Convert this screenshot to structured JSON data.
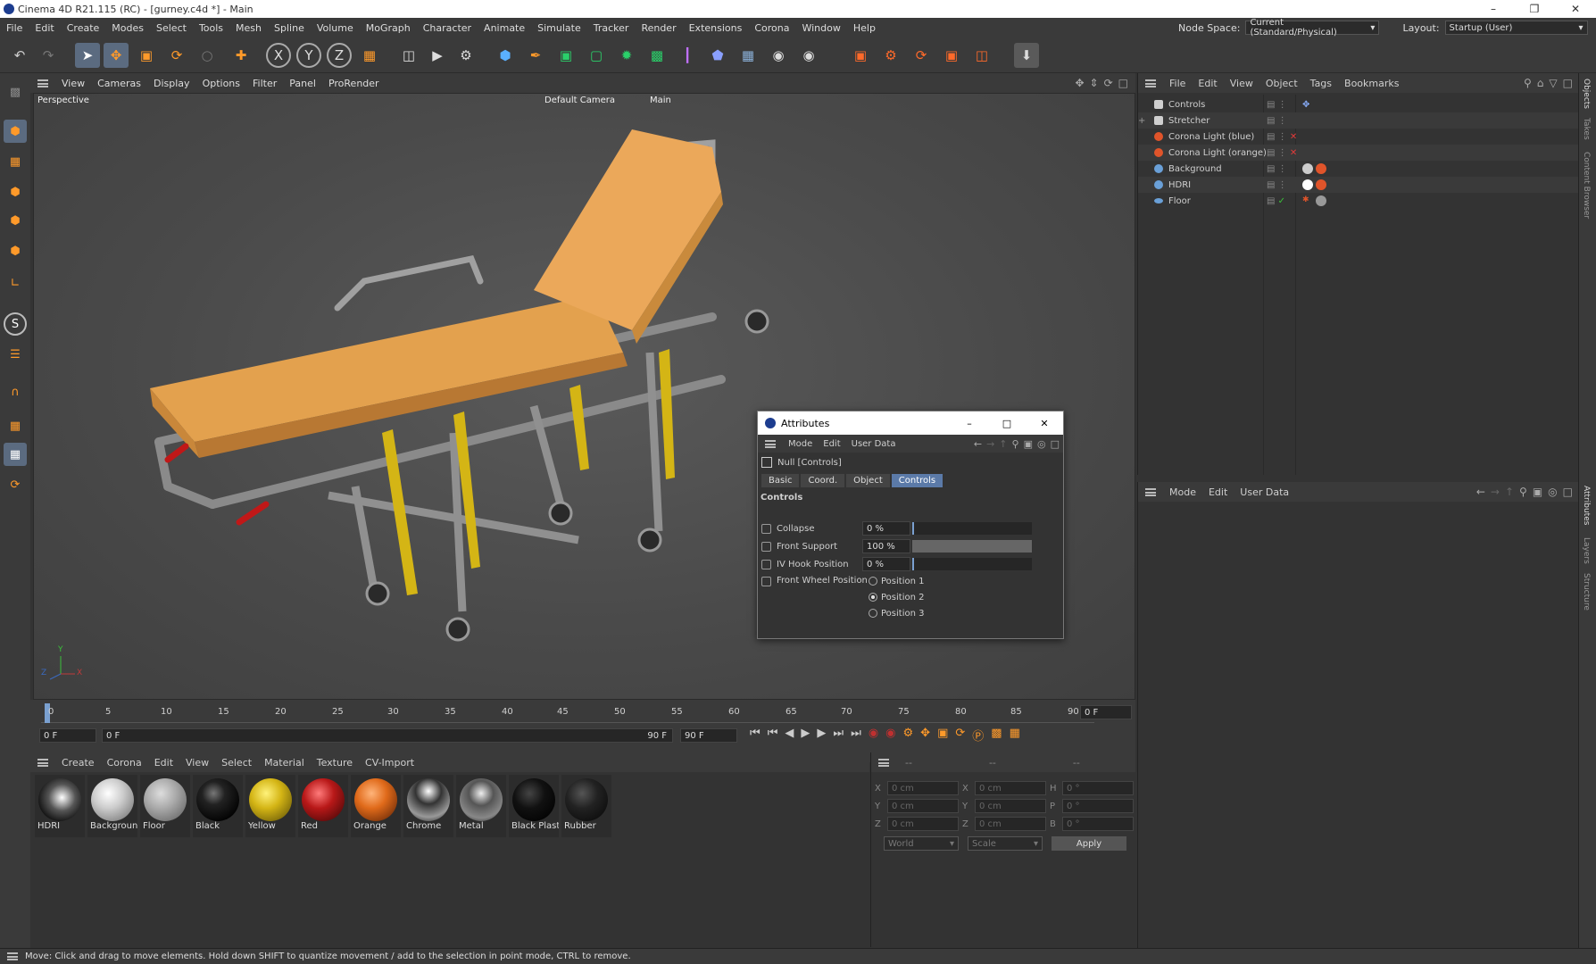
{
  "window": {
    "title": "Cinema 4D R21.115 (RC) - [gurney.c4d *] - Main"
  },
  "menubar": {
    "items": [
      "File",
      "Edit",
      "Create",
      "Modes",
      "Select",
      "Tools",
      "Mesh",
      "Spline",
      "Volume",
      "MoGraph",
      "Character",
      "Animate",
      "Simulate",
      "Tracker",
      "Render",
      "Extensions",
      "Corona",
      "Window",
      "Help"
    ],
    "node_space_label": "Node Space:",
    "node_space_value": "Current (Standard/Physical)",
    "layout_label": "Layout:",
    "layout_value": "Startup (User)"
  },
  "viewport": {
    "menu": [
      "View",
      "Cameras",
      "Display",
      "Options",
      "Filter",
      "Panel",
      "ProRender"
    ],
    "view_name": "Perspective",
    "camera": "Default Camera",
    "camera_suffix": "Main",
    "axes": {
      "x": "X",
      "y": "Y",
      "z": "Z"
    }
  },
  "timeline": {
    "ticks": [
      "0",
      "5",
      "10",
      "15",
      "20",
      "25",
      "30",
      "35",
      "40",
      "45",
      "50",
      "55",
      "60",
      "65",
      "70",
      "75",
      "80",
      "85",
      "90"
    ],
    "current_frame": "0 F",
    "start_frame": "0 F",
    "range_start": "0 F",
    "range_end": "90 F",
    "end_frame": "90 F"
  },
  "material_manager": {
    "menu": [
      "Create",
      "Corona",
      "Edit",
      "View",
      "Select",
      "Material",
      "Texture",
      "CV-Import"
    ],
    "materials": [
      {
        "name": "HDRI",
        "color": "#d8d8d8"
      },
      {
        "name": "Backgrounc",
        "color": "#c8c8c8"
      },
      {
        "name": "Floor",
        "color": "#9a9a9a"
      },
      {
        "name": "Black",
        "color": "#1a1a1a"
      },
      {
        "name": "Yellow",
        "color": "#d4b515"
      },
      {
        "name": "Red",
        "color": "#b81818"
      },
      {
        "name": "Orange",
        "color": "#e06a1a"
      },
      {
        "name": "Chrome",
        "color": "#606060"
      },
      {
        "name": "Metal",
        "color": "#707070"
      },
      {
        "name": "Black Plastic",
        "color": "#151515"
      },
      {
        "name": "Rubber",
        "color": "#222222"
      }
    ]
  },
  "coordinates": {
    "headers": [
      "--",
      "--",
      "--"
    ],
    "rows": [
      {
        "a": "X",
        "av": "0 cm",
        "b": "X",
        "bv": "0 cm",
        "c": "H",
        "cv": "0 °"
      },
      {
        "a": "Y",
        "av": "0 cm",
        "b": "Y",
        "bv": "0 cm",
        "c": "P",
        "cv": "0 °"
      },
      {
        "a": "Z",
        "av": "0 cm",
        "b": "Z",
        "bv": "0 cm",
        "c": "B",
        "cv": "0 °"
      }
    ],
    "space": "World",
    "mode": "Scale",
    "apply": "Apply"
  },
  "object_manager": {
    "menu": [
      "File",
      "Edit",
      "View",
      "Object",
      "Tags",
      "Bookmarks"
    ],
    "objects": [
      {
        "name": "Controls",
        "icon_color": "#cfcfcf"
      },
      {
        "name": "Stretcher",
        "icon_color": "#cfcfcf"
      },
      {
        "name": "Corona Light (blue)",
        "icon_color": "#e0542a"
      },
      {
        "name": "Corona Light (orange)",
        "icon_color": "#e0542a"
      },
      {
        "name": "Background",
        "icon_color": "#6aa0d8"
      },
      {
        "name": "HDRI",
        "icon_color": "#6aa0d8"
      },
      {
        "name": "Floor",
        "icon_color": "#6aa0d8"
      }
    ]
  },
  "attribute_manager": {
    "menu": [
      "Mode",
      "Edit",
      "User Data"
    ]
  },
  "attributes_window": {
    "title": "Attributes",
    "menu": [
      "Mode",
      "Edit",
      "User Data"
    ],
    "object": "Null [Controls]",
    "tabs": [
      "Basic",
      "Coord.",
      "Object",
      "Controls"
    ],
    "active_tab": "Controls",
    "section": "Controls",
    "params": [
      {
        "label": "Collapse",
        "value": "0 %",
        "fill": 0
      },
      {
        "label": "Front Support",
        "value": "100 %",
        "fill": 100
      },
      {
        "label": "IV Hook Position",
        "value": "0 %",
        "fill": 0
      }
    ],
    "radio_label": "Front Wheel Position",
    "radio_options": [
      "Position 1",
      "Position 2",
      "Position 3"
    ],
    "radio_selected": "Position 2"
  },
  "right_tabs": [
    "Objects",
    "Takes",
    "Content Browser",
    "Attributes",
    "Layers",
    "Structure"
  ],
  "status": "Move: Click and drag to move elements. Hold down SHIFT to quantize movement / add to the selection in point mode, CTRL to remove."
}
